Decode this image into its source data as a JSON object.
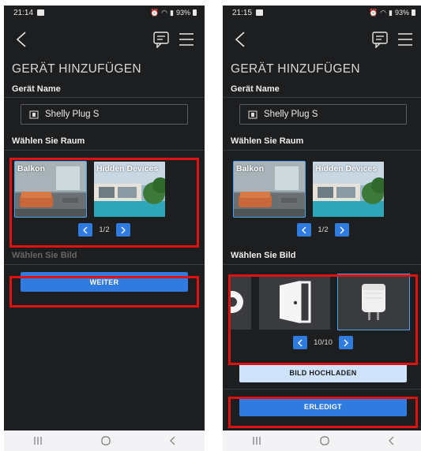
{
  "left": {
    "status": {
      "time": "21:14",
      "battery": "93%"
    },
    "title": "GERÄT HINZUFÜGEN",
    "device_name_label": "Gerät Name",
    "device_name_value": "Shelly Plug S",
    "room_label": "Wählen Sie Raum",
    "rooms": [
      {
        "name": "Balkon"
      },
      {
        "name": "Hidden Devices"
      }
    ],
    "room_pager": "1/2",
    "image_label": "Wählen Sie Bild",
    "next_button": "WEITER"
  },
  "right": {
    "status": {
      "time": "21:15",
      "battery": "93%"
    },
    "title": "GERÄT HINZUFÜGEN",
    "device_name_label": "Gerät Name",
    "device_name_value": "Shelly Plug S",
    "room_label": "Wählen Sie Raum",
    "rooms": [
      {
        "name": "Balkon"
      },
      {
        "name": "Hidden Devices"
      }
    ],
    "room_pager": "1/2",
    "image_label": "Wählen Sie Bild",
    "image_pager": "10/10",
    "upload_button": "BILD HOCHLADEN",
    "done_button": "ERLEDIGT"
  },
  "colors": {
    "accent": "#2f7be0",
    "highlight": "#e0110f",
    "background": "#1d1e20"
  }
}
